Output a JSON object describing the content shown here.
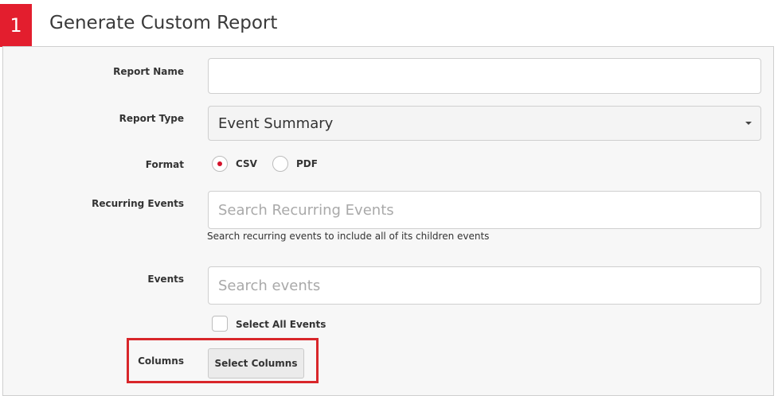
{
  "header": {
    "step_number": "1",
    "title": "Generate Custom Report"
  },
  "form": {
    "report_name": {
      "label": "Report Name",
      "value": ""
    },
    "report_type": {
      "label": "Report Type",
      "selected": "Event Summary"
    },
    "format": {
      "label": "Format",
      "options": [
        {
          "label": "CSV",
          "checked": true
        },
        {
          "label": "PDF",
          "checked": false
        }
      ]
    },
    "recurring_events": {
      "label": "Recurring Events",
      "placeholder": "Search Recurring Events",
      "help": "Search recurring events to include all of its children events"
    },
    "events": {
      "label": "Events",
      "placeholder": "Search events",
      "select_all_label": "Select All Events",
      "select_all_checked": false
    },
    "columns": {
      "label": "Columns",
      "button_label": "Select Columns"
    }
  },
  "colors": {
    "accent": "#e31e2e",
    "highlight_border": "#d8262a",
    "panel_bg": "#f7f7f7"
  }
}
